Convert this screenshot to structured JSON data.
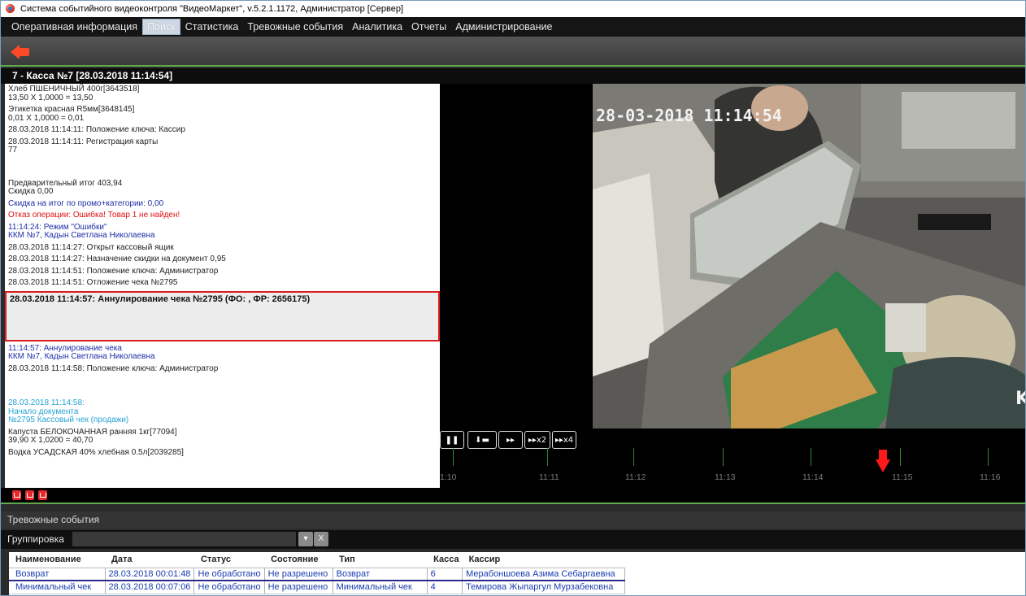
{
  "window": {
    "title": "Система событийного видеоконтроля \"ВидеоМаркет\", v.5.2.1.1172, Администратор  [Сервер]"
  },
  "menu": {
    "items": [
      "Оперативная информация",
      "Поиск",
      "Статистика",
      "Тревожные события",
      "Аналитика",
      "Отчеты",
      "Администрирование"
    ],
    "active": "Поиск"
  },
  "pane": {
    "header": "7 - Касса №7   [28.03.2018 11:14:54]"
  },
  "events": [
    {
      "lines": [
        "Хлеб ПШЕНИЧНЫЙ 400г[3643518]",
        "13,50 X 1,0000 = 13,50"
      ],
      "style": "normal"
    },
    {
      "lines": [
        "Этикетка красная R5мм[3648145]",
        "0,01 X 1,0000 = 0,01"
      ],
      "style": "normal"
    },
    {
      "lines": [
        "28.03.2018 11:14:11: Положение ключа: Кассир"
      ],
      "style": "normal"
    },
    {
      "lines": [
        "28.03.2018 11:14:11: Регистрация карты",
        "77"
      ],
      "style": "normal"
    },
    {
      "lines": [
        "Предварительный итог 403,94",
        "Скидка 0,00"
      ],
      "style": "normal",
      "gap_before": true
    },
    {
      "lines": [
        "Скидка на итог по промо+категории:  0,00"
      ],
      "style": "blue"
    },
    {
      "lines": [
        "Отказ операции: Ошибка! Товар 1 не найден!"
      ],
      "style": "red"
    },
    {
      "lines": [
        "11:14:24: Режим \"Ошибки\"",
        "ККМ №7, Кадын Светлана Николаевна"
      ],
      "style": "blue"
    },
    {
      "lines": [
        "28.03.2018 11:14:27: Открыт кассовый ящик"
      ],
      "style": "normal"
    },
    {
      "lines": [
        "28.03.2018 11:14:27: Назначение скидки на документ 0,95"
      ],
      "style": "normal"
    },
    {
      "lines": [
        "28.03.2018 11:14:51: Положение ключа: Администратор"
      ],
      "style": "normal"
    },
    {
      "lines": [
        "28.03.2018 11:14:51: Отложение чека №2795"
      ],
      "style": "normal"
    }
  ],
  "selected_event": "28.03.2018 11:14:57: Аннулирование чека №2795 (ФО: , ФР: 2656175)",
  "events_after": [
    {
      "lines": [
        "11:14:57: Аннулирование чека",
        "ККМ №7, Кадын Светлана Николаевна"
      ],
      "style": "blue"
    },
    {
      "lines": [
        "28.03.2018 11:14:58: Положение ключа: Администратор"
      ],
      "style": "normal"
    },
    {
      "lines": [
        "28.03.2018 11:14:58:",
        "Начало документа",
        "№2795 Кассовый чек (продажи)"
      ],
      "style": "cyan",
      "gap_before": true
    },
    {
      "lines": [
        "Капуста БЕЛОКОЧАННАЯ ранняя 1кг[77094]",
        "39,90 X 1,0200 = 40,70"
      ],
      "style": "normal"
    },
    {
      "lines": [
        "Водка УСАДСКАЯ 40% хлебная 0.5л[2039285]"
      ],
      "style": "normal"
    }
  ],
  "video": {
    "overlay_timestamp": "28-03-2018 11:14:54",
    "edge_letter": "K"
  },
  "player": {
    "buttons": [
      {
        "name": "pause-button",
        "label": "❚❚"
      },
      {
        "name": "step-frame-button",
        "label": "⬇▬"
      },
      {
        "name": "play-button",
        "label": "▸▸"
      },
      {
        "name": "play-x2-button",
        "label": "▸▸x2"
      },
      {
        "name": "play-x4-button",
        "label": "▸▸x4"
      }
    ],
    "timeline_labels": [
      "1:10",
      "11:11",
      "11:12",
      "11:13",
      "11:14",
      "11:15",
      "11:16"
    ]
  },
  "alarms": {
    "title": "Тревожные события",
    "grouping_label": "Группировка",
    "dropdown_icon": "chevron-down-icon",
    "clear_label": "X",
    "columns": [
      "Наименование",
      "Дата",
      "Статус",
      "Состояние",
      "Тип",
      "Касса",
      "Кассир"
    ],
    "rows": [
      [
        "Возврат",
        "28.03.2018 00:01:48",
        "Не обработано",
        "Не разрешено",
        "Возврат",
        "6",
        "Мерабоншоева Азима Себаргаевна"
      ],
      [
        "Минимальный чек",
        "28.03.2018 00:07:06",
        "Не обработано",
        "Не разрешено",
        "Минимальный чек",
        "4",
        "Темирова Жыпаргул Мурзабековна"
      ]
    ]
  },
  "colors": {
    "accent_green": "#5fa84b",
    "selection_border": "#d91e1e",
    "link_blue": "#1a3cb0",
    "marker_red": "#ff1a1a"
  }
}
